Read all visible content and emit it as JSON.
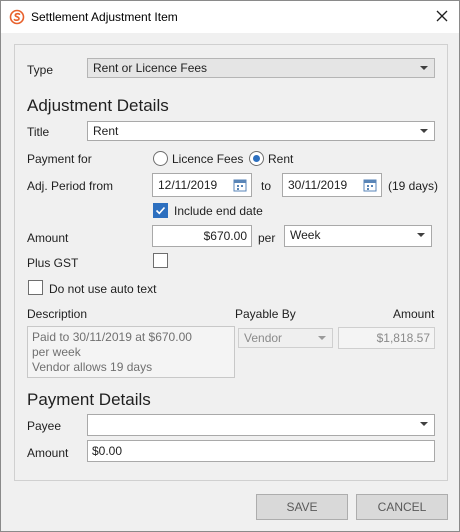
{
  "window": {
    "title": "Settlement Adjustment Item",
    "icon": "logo-icon",
    "close_icon": "close-icon"
  },
  "type_field": {
    "label": "Type",
    "value": "Rent or Licence Fees"
  },
  "adjustment_details": {
    "heading": "Adjustment Details",
    "title_label": "Title",
    "title_value": "Rent",
    "payment_for_label": "Payment for",
    "payment_options": [
      {
        "label": "Licence Fees",
        "selected": false
      },
      {
        "label": "Rent",
        "selected": true
      }
    ],
    "period_label": "Adj. Period from",
    "period_from": "12/11/2019",
    "period_to_label": "to",
    "period_to": "30/11/2019",
    "period_days": "(19 days)",
    "include_end_date_label": "Include end date",
    "include_end_date": true,
    "amount_label": "Amount",
    "amount_value": "$670.00",
    "per_label": "per",
    "per_value": "Week",
    "plus_gst_label": "Plus GST",
    "plus_gst": false,
    "auto_text_label": "Do not use auto text",
    "auto_text": false,
    "description_header": "Description",
    "payable_by_header": "Payable By",
    "amount_header": "Amount",
    "description_lines": [
      "Paid to 30/11/2019 at $670.00",
      "per week",
      "Vendor allows 19 days"
    ],
    "payable_by_value": "Vendor",
    "computed_amount": "$1,818.57"
  },
  "payment_details": {
    "heading": "Payment Details",
    "payee_label": "Payee",
    "payee_value": "",
    "amount_label": "Amount",
    "amount_value": "$0.00"
  },
  "buttons": {
    "save": "SAVE",
    "cancel": "CANCEL"
  },
  "colors": {
    "accent": "#2c6fbf",
    "logo": "#e8612c"
  }
}
